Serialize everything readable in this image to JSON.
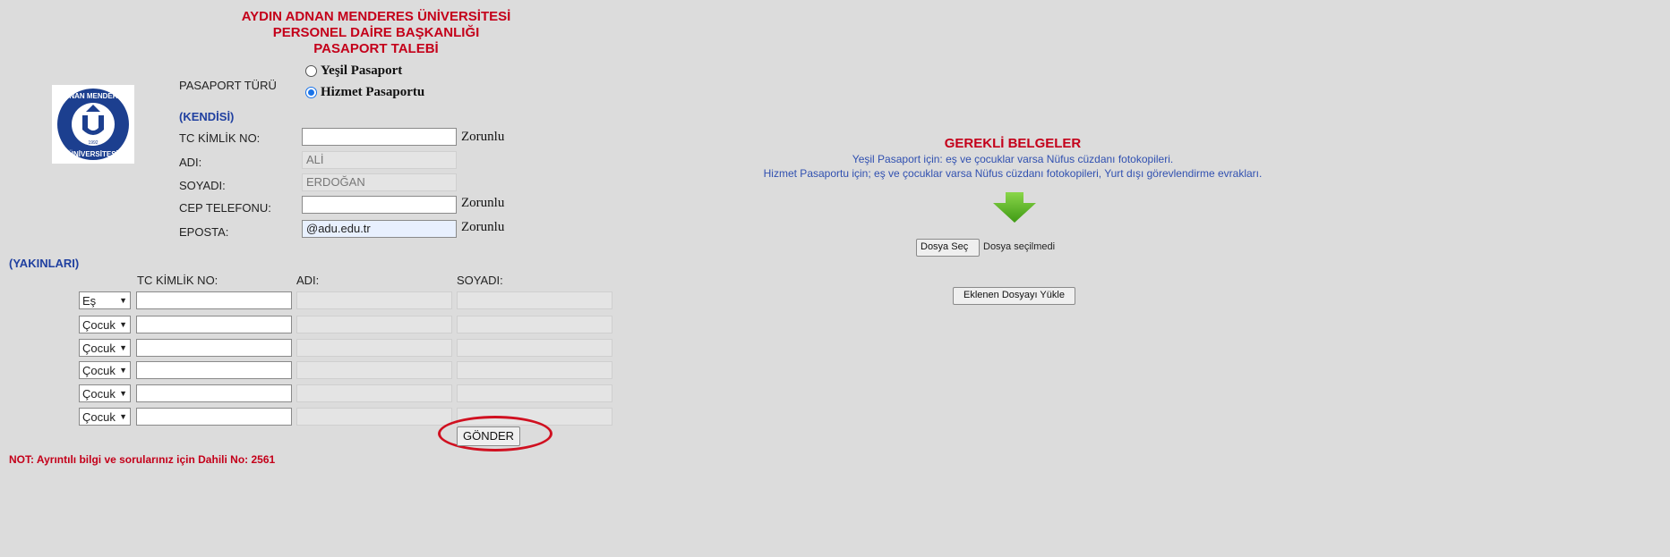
{
  "header": {
    "line1": "AYDIN ADNAN MENDERES ÜNİVERSİTESİ",
    "line2": "PERSONEL DAİRE BAŞKANLIĞI",
    "line3": "PASAPORT TALEBİ"
  },
  "logo": {
    "text_top": "ADNAN MENDERES",
    "text_bottom": "ÜNİVERSİTESİ",
    "year": "1992"
  },
  "passport_type": {
    "label": "PASAPORT TÜRÜ",
    "options": [
      "Yeşil Pasaport",
      "Hizmet Pasaportu"
    ],
    "selected": "Hizmet Pasaportu"
  },
  "self": {
    "section_label": "(KENDİSİ)",
    "tc_label": "TC KİMLİK NO:",
    "tc_value": "",
    "name_label": "ADI:",
    "name_value": "ALİ",
    "surname_label": "SOYADI:",
    "surname_value": "ERDOĞAN",
    "phone_label": "CEP TELEFONU:",
    "phone_value": "",
    "email_label": "EPOSTA:",
    "email_value": "@adu.edu.tr",
    "required": "Zorunlu"
  },
  "relatives": {
    "section_label": "(YAKINLARI)",
    "headers": {
      "tc": "TC KİMLİK NO:",
      "name": "ADI:",
      "surname": "SOYADI:"
    },
    "rows": [
      {
        "relation": "Eş"
      },
      {
        "relation": "Çocuk"
      },
      {
        "relation": "Çocuk"
      },
      {
        "relation": "Çocuk"
      },
      {
        "relation": "Çocuk"
      },
      {
        "relation": "Çocuk"
      }
    ]
  },
  "submit_label": "GÖNDER",
  "note": "NOT: Ayrıntılı bilgi ve sorularınız için Dahili No: 2561",
  "documents": {
    "title": "GEREKLİ BELGELER",
    "line1": "Yeşil Pasaport için: eş ve çocuklar varsa Nüfus cüzdanı fotokopileri.",
    "line2": "Hizmet Pasaportu için; eş ve çocuklar varsa Nüfus cüzdanı fotokopileri, Yurt dışı görevlendirme evrakları.",
    "choose_file": "Dosya Seç",
    "no_file": "Dosya seçilmedi",
    "upload": "Eklenen Dosyayı Yükle"
  },
  "colors": {
    "accent_red": "#c4001a",
    "label_blue": "#2040a0",
    "arrow_green": "#5ab61e"
  }
}
